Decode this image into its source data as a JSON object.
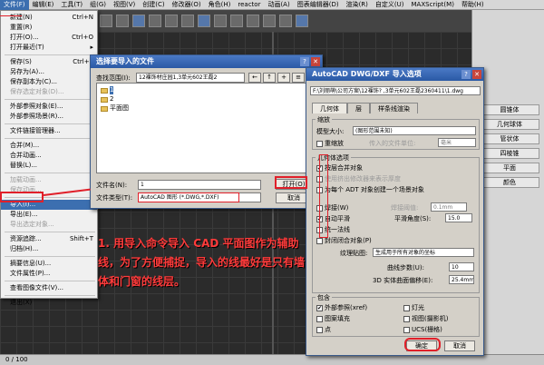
{
  "menubar": {
    "items": [
      "文件(F)",
      "编辑(E)",
      "工具(T)",
      "组(G)",
      "视图(V)",
      "创建(C)",
      "修改器(O)",
      "角色(H)",
      "reactor",
      "动画(A)",
      "图表编辑器(D)",
      "渲染(R)",
      "自定义(U)",
      "MAXScript(M)",
      "帮助(H)"
    ]
  },
  "file_menu": {
    "items": [
      {
        "label": "新建(N)",
        "shortcut": "Ctrl+N"
      },
      {
        "label": "重置(R)",
        "shortcut": ""
      },
      {
        "label": "打开(O)...",
        "shortcut": "Ctrl+O"
      },
      {
        "label": "打开最近(T)",
        "shortcut": "▸"
      },
      {
        "label": "保存(S)",
        "shortcut": "Ctrl+S"
      },
      {
        "label": "另存为(A)...",
        "shortcut": ""
      },
      {
        "label": "保存副本为(C)...",
        "shortcut": ""
      },
      {
        "label": "保存选定对象(D)...",
        "shortcut": ""
      },
      {
        "label": "外部参照对象(E)...",
        "shortcut": ""
      },
      {
        "label": "外部参照场景(R)...",
        "shortcut": ""
      },
      {
        "label": "文件链接管理器...",
        "shortcut": ""
      },
      {
        "label": "合并(M)...",
        "shortcut": ""
      },
      {
        "label": "合并动画...",
        "shortcut": ""
      },
      {
        "label": "替换(L)...",
        "shortcut": ""
      },
      {
        "label": "加载动画...",
        "shortcut": ""
      },
      {
        "label": "保存动画...",
        "shortcut": ""
      },
      {
        "label": "导入(I)...",
        "shortcut": ""
      },
      {
        "label": "导出(E)...",
        "shortcut": ""
      },
      {
        "label": "导出选定对象...",
        "shortcut": ""
      },
      {
        "label": "资源追踪...",
        "shortcut": "Shift+T"
      },
      {
        "label": "归档(H)...",
        "shortcut": ""
      },
      {
        "label": "摘要信息(U)...",
        "shortcut": ""
      },
      {
        "label": "文件属性(P)...",
        "shortcut": ""
      },
      {
        "label": "查看图像文件(V)...",
        "shortcut": ""
      },
      {
        "label": "退出(X)",
        "shortcut": ""
      }
    ]
  },
  "import_dialog": {
    "title": "选择要导入的文件",
    "lookin_label": "查找范围(I):",
    "lookin_value": "12裸饰材庄园1,3单元602王磊2",
    "files": [
      "1",
      "2",
      "平面图"
    ],
    "filename_label": "文件名(N):",
    "filename_value": "1",
    "filetype_label": "文件类型(T):",
    "filetype_value": "AutoCAD 图形 (*.DWG,*.DXF)",
    "open_button": "打开(O)",
    "cancel_button": "取消"
  },
  "cad_dialog": {
    "title": "AutoCAD DWG/DXF 导入选项",
    "path": "F:\\刘丽萌\\公司方案\\12裸饰? ,3单元602王磊2360411\\1.dwg",
    "tabs": [
      "几何体",
      "层",
      "样条线渲染"
    ],
    "scale_group": "缩放",
    "model_size_label": "模型大小:",
    "model_size_value": "(图形范围未知)",
    "rescale_label": "重缩放",
    "incoming_units_label": "传入的文件单位:",
    "incoming_units_value": "毫米",
    "geometry_group": "几何体选项",
    "geometry_options": [
      {
        "label": "按层合并对象",
        "checked": true,
        "enabled": true
      },
      {
        "label": "使用挤出修改器来表示厚度",
        "checked": false,
        "enabled": false
      },
      {
        "label": "为每个 ADT 对象创建一个场景对象",
        "checked": false,
        "enabled": true
      },
      {
        "label": "焊接(W)",
        "checked": false,
        "enabled": true
      },
      {
        "label": "自动平滑",
        "checked": true,
        "enabled": true
      },
      {
        "label": "统一法线",
        "checked": false,
        "enabled": true
      },
      {
        "label": "封闭闭合对象(P)",
        "checked": false,
        "enabled": true
      }
    ],
    "weld_threshold_label": "焊接阈值:",
    "weld_threshold_value": "0.1mm",
    "smooth_angle_label": "平滑角度(S):",
    "smooth_angle_value": "15.0",
    "texture_label": "纹理贴图:",
    "texture_value": "生成用于所有对象的坐标",
    "curve_steps_label": "曲线步数(U):",
    "curve_steps_value": "10",
    "surface_dev_label": "3D 实体曲面偏移(E):",
    "surface_dev_value": "25.4mm",
    "include_group": "包含",
    "include_options": [
      {
        "label": "外部参照(xref)",
        "checked": true
      },
      {
        "label": "图案填充",
        "checked": false
      },
      {
        "label": "点",
        "checked": false
      },
      {
        "label": "灯光",
        "checked": false
      },
      {
        "label": "视图(摄影机)",
        "checked": false
      },
      {
        "label": "UCS(栅格)",
        "checked": false
      }
    ],
    "ok_button": "确定",
    "cancel_button": "取消"
  },
  "command_panel": {
    "items": [
      "圆锥体",
      "几何球体",
      "管状体",
      "四棱锥",
      "平面",
      "颜色"
    ]
  },
  "status": {
    "frame": "0 / 100"
  },
  "annotation": "1. 用导入命令导入 CAD 平面图作为辅助线，为了方便捕捉，导入的线最好是只有墙体和门窗的线层。"
}
